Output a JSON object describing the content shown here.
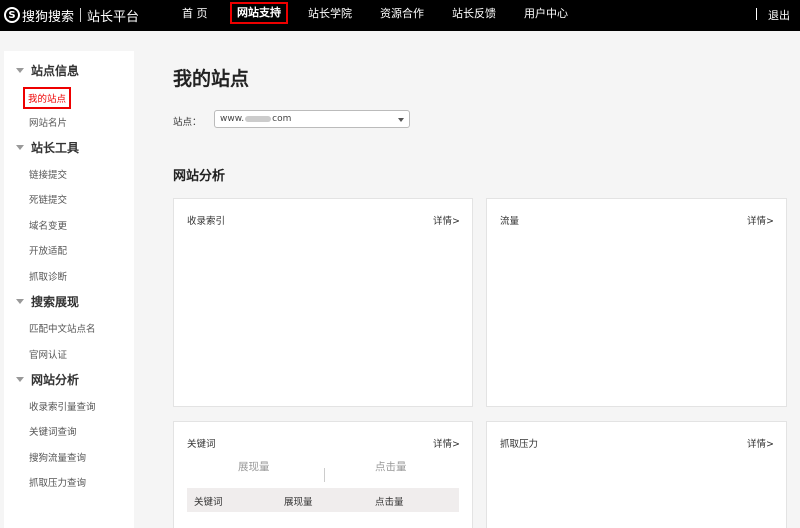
{
  "topbar": {
    "logo_mark": "S",
    "logo_brand": "搜狗搜索",
    "logo_product": "站长平台",
    "nav": [
      "首 页",
      "网站支持",
      "站长学院",
      "资源合作",
      "站长反馈",
      "用户中心"
    ],
    "active_nav": "网站支持",
    "logout": "退出"
  },
  "sidebar": {
    "groups": [
      {
        "title": "站点信息",
        "items": [
          "我的站点",
          "网站名片"
        ]
      },
      {
        "title": "站长工具",
        "items": [
          "链接提交",
          "死链提交",
          "域名变更",
          "开放适配",
          "抓取诊断"
        ]
      },
      {
        "title": "搜索展现",
        "items": [
          "匹配中文站点名",
          "官网认证"
        ]
      },
      {
        "title": "网站分析",
        "items": [
          "收录索引量查询",
          "关键词查询",
          "搜狗流量查询",
          "抓取压力查询"
        ]
      }
    ],
    "active_item": "我的站点"
  },
  "main": {
    "title": "我的站点",
    "site_label": "站点：",
    "site_value_prefix": "www.",
    "site_value_suffix": "com",
    "section_title": "网站分析",
    "cards": [
      {
        "title": "收录索引",
        "more": "详情>"
      },
      {
        "title": "流量",
        "more": "详情>"
      },
      {
        "title": "关键词",
        "more": "详情>"
      },
      {
        "title": "抓取压力",
        "more": "详情>"
      }
    ],
    "keyword_metrics": [
      "展现量",
      "点击量"
    ],
    "keyword_table_headers": [
      "关键词",
      "展现量",
      "点击量"
    ]
  }
}
